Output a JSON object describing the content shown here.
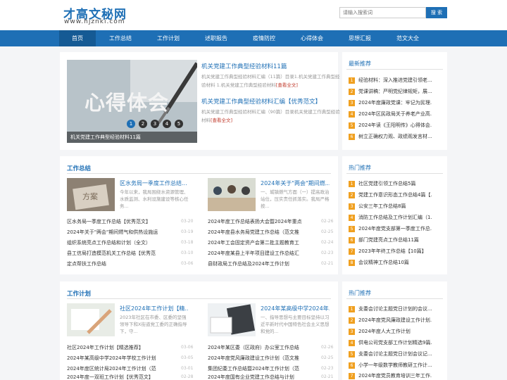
{
  "header": {
    "logo": "才高文秘网",
    "url": "www.hjznki.com",
    "search_placeholder": "请输入搜索词",
    "search_button": "搜 索"
  },
  "nav": [
    "首页",
    "工作总结",
    "工作计划",
    "述职报告",
    "疫情防控",
    "心得体会",
    "思想汇报",
    "范文大全"
  ],
  "featured": {
    "slide_text": "心得体会",
    "slide_caption": "机关党建工作典型经验材料11篇",
    "dots": [
      "1",
      "2",
      "3",
      "4",
      "5"
    ],
    "items": [
      {
        "title": "机关党建工作典型经验材料11篇",
        "desc": "机关党建工作典型经验材料汇编（11篇）目录1.机关党建工作典型经验材料 1.机关党建工作典型经验材料",
        "more": "[查看全文]"
      },
      {
        "title": "机关党建工作典型经验材料汇编【优秀范文】",
        "desc": "机关党建工作典型经验材料汇编（90篇）目录机关党建工作典型经验材料",
        "more": "[查看全文]"
      }
    ]
  },
  "latest": {
    "title": "最新推荐",
    "items": [
      {
        "num": "1",
        "text": "经验材料：深入推进党建引领老..."
      },
      {
        "num": "2",
        "text": "党课讲稿：严明党纪律规矩，展..."
      },
      {
        "num": "3",
        "text": "2024年度廉政党课：牢记为民理..."
      },
      {
        "num": "4",
        "text": "2024年区民政局关于养老产业高..."
      },
      {
        "num": "5",
        "text": "2024年读《王阳明传》心得体会..."
      },
      {
        "num": "6",
        "text": "树立正确权力观、政绩观发言材..."
      }
    ]
  },
  "hot1": {
    "title": "热门推荐",
    "items": [
      {
        "num": "1",
        "text": "社区党建引领工作总结5篇"
      },
      {
        "num": "2",
        "text": "党建工作意识形态工作总结4篇【..."
      },
      {
        "num": "3",
        "text": "公安三年工作总结8篇"
      },
      {
        "num": "4",
        "text": "消防工作总结及工作计划汇编（1..."
      },
      {
        "num": "5",
        "text": "2024年度党支部第一季度工作总..."
      },
      {
        "num": "6",
        "text": "部门党建亮点工作总结11篇"
      },
      {
        "num": "7",
        "text": "2023年年终工作总结【10篇】"
      },
      {
        "num": "8",
        "text": "会议精神工作总结10篇"
      }
    ]
  },
  "hot2": {
    "title": "热门推荐",
    "items": [
      {
        "num": "1",
        "text": "支委会讨论主题党日计划的会议..."
      },
      {
        "num": "2",
        "text": "2024年度党风廉政建设工作计划..."
      },
      {
        "num": "3",
        "text": "2024年度人大工作计划"
      },
      {
        "num": "4",
        "text": "供电公司党支部工作计划精选9篇..."
      },
      {
        "num": "5",
        "text": "支委会讨论主题党日计划会议记..."
      },
      {
        "num": "6",
        "text": "小学一年级数学教师教研工作计..."
      },
      {
        "num": "7",
        "text": "2024年度党员教育培训三年工作..."
      }
    ]
  },
  "summary": {
    "title": "工作总结",
    "cards": [
      {
        "title": "区水务局一季度工作总结...",
        "desc": "今年以来，我局围绕水资源管理、水质监测、水利设施建设等核心任务..."
      },
      {
        "title": "2024年关于\"两会\"期间燃...",
        "desc": "一、城镇燃气方面（一）提高政治站位，压实责任抓落实。我局严格按..."
      }
    ],
    "left": [
      {
        "text": "区水务局一季度工作总结【优秀范文】",
        "date": "03-20"
      },
      {
        "text": "2024年关于\"两会\"期间燃气和供热设施运",
        "date": "03-19"
      },
      {
        "text": "组织系统亮点工作总结和计划（全文）",
        "date": "03-18"
      },
      {
        "text": "县工信局打造模范机关工作总结【优秀范",
        "date": "03-10"
      },
      {
        "text": "定点帮扶工作总结",
        "date": "03-06"
      }
    ],
    "right": [
      {
        "text": "2024年度工作总结表扬大会暨2024年重点",
        "date": "02-26"
      },
      {
        "text": "2024年度县水务局党建工作总结（范文推",
        "date": "02-25"
      },
      {
        "text": "2024年工会固定资产会第二批主题教育工",
        "date": "02-24"
      },
      {
        "text": "2024年度某县上半年项目建设工作总结汇",
        "date": "02-23"
      },
      {
        "text": "县财政局工作总结及2024年工作计划",
        "date": "02-21"
      }
    ]
  },
  "plan": {
    "title": "工作计划",
    "cards": [
      {
        "title": "社区2024年工作计划【精...",
        "desc": "2023年社区在市委、区委的坚强领导下和X街道党工委的正确指导下，守..."
      },
      {
        "title": "2024年某高级中学2024年...",
        "desc": "一、指导思想与主要目标坚持以习近平新时代中国特色社会主义思想和党的..."
      }
    ],
    "left": [
      {
        "text": "社区2024年工作计划【精选推荐】",
        "date": "03-06"
      },
      {
        "text": "2024年某高级中学2024年学校工作计划",
        "date": "03-05"
      },
      {
        "text": "2024年度区统计局2024年工作计划（范",
        "date": "03-01"
      },
      {
        "text": "2024年度一双班工作计划【优秀范文】",
        "date": "02-28"
      }
    ],
    "right": [
      {
        "text": "2024年某区委（区政府）办公室工作总结",
        "date": "02-26"
      },
      {
        "text": "2024年度党风廉政建设工作计划（范文推",
        "date": "02-25"
      },
      {
        "text": "集团纪委工作总结暨2024年工作计划（范",
        "date": "02-23"
      },
      {
        "text": "2024年度国有企业党建工作总结与计划",
        "date": "02-21"
      }
    ]
  }
}
